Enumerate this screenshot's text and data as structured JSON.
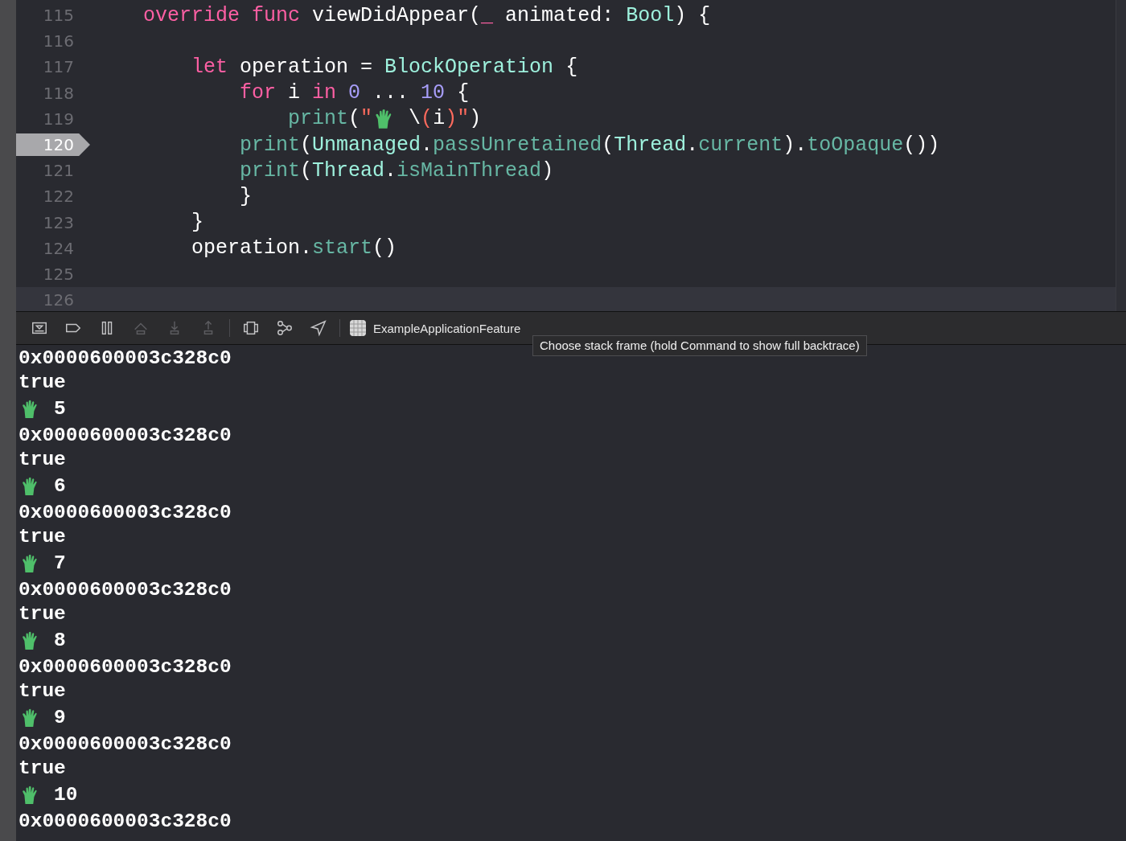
{
  "editor": {
    "lines": [
      {
        "number": "115",
        "highlighted": false,
        "pointer": false,
        "tokens": [
          {
            "kind": "kw",
            "text": "    override"
          },
          {
            "kind": "kw",
            "text": " func"
          },
          {
            "kind": "plain",
            "text": " viewDidAppear("
          },
          {
            "kind": "kw",
            "text": "_"
          },
          {
            "kind": "plain",
            "text": " animated: "
          },
          {
            "kind": "type",
            "text": "Bool"
          },
          {
            "kind": "plain",
            "text": ") {"
          }
        ]
      },
      {
        "number": "116",
        "highlighted": false,
        "pointer": false
      },
      {
        "number": "117",
        "highlighted": false,
        "pointer": false,
        "tokens": [
          {
            "kind": "kw",
            "text": "        let"
          },
          {
            "kind": "plain",
            "text": " operation = "
          },
          {
            "kind": "type",
            "text": "BlockOperation"
          },
          {
            "kind": "plain",
            "text": " {"
          }
        ]
      },
      {
        "number": "118",
        "highlighted": false,
        "pointer": false,
        "tokens": [
          {
            "kind": "kw",
            "text": "            for"
          },
          {
            "kind": "plain",
            "text": " i "
          },
          {
            "kind": "kw",
            "text": "in"
          },
          {
            "kind": "num",
            "text": " 0"
          },
          {
            "kind": "plain",
            "text": " ... "
          },
          {
            "kind": "num",
            "text": "10"
          },
          {
            "kind": "plain",
            "text": " {"
          }
        ]
      },
      {
        "number": "119",
        "highlighted": false,
        "pointer": false,
        "tokens": [
          {
            "kind": "fn",
            "text": "                print"
          },
          {
            "kind": "plain",
            "text": "("
          },
          {
            "kind": "str",
            "text": "\""
          },
          {
            "kind": "icon"
          },
          {
            "kind": "plain",
            "text": " \\"
          },
          {
            "kind": "str",
            "text": "("
          },
          {
            "kind": "plain",
            "text": "i"
          },
          {
            "kind": "str",
            "text": ")\""
          },
          {
            "kind": "plain",
            "text": ")"
          }
        ]
      },
      {
        "number": "120",
        "highlighted": false,
        "pointer": true,
        "tokens": [
          {
            "kind": "fn",
            "text": "            print"
          },
          {
            "kind": "plain",
            "text": "("
          },
          {
            "kind": "type",
            "text": "Unmanaged"
          },
          {
            "kind": "plain",
            "text": "."
          },
          {
            "kind": "fn",
            "text": "passUnretained"
          },
          {
            "kind": "plain",
            "text": "("
          },
          {
            "kind": "type",
            "text": "Thread"
          },
          {
            "kind": "plain",
            "text": "."
          },
          {
            "kind": "fn",
            "text": "current"
          },
          {
            "kind": "plain",
            "text": ")."
          },
          {
            "kind": "fn",
            "text": "toOpaque"
          },
          {
            "kind": "plain",
            "text": "())"
          }
        ]
      },
      {
        "number": "121",
        "highlighted": false,
        "pointer": false,
        "tokens": [
          {
            "kind": "fn",
            "text": "            print"
          },
          {
            "kind": "plain",
            "text": "("
          },
          {
            "kind": "type",
            "text": "Thread"
          },
          {
            "kind": "plain",
            "text": "."
          },
          {
            "kind": "fn",
            "text": "isMainThread"
          },
          {
            "kind": "plain",
            "text": ")"
          }
        ]
      },
      {
        "number": "122",
        "highlighted": false,
        "pointer": false,
        "tokens": [
          {
            "kind": "plain",
            "text": "            }"
          }
        ]
      },
      {
        "number": "123",
        "highlighted": false,
        "pointer": false,
        "tokens": [
          {
            "kind": "plain",
            "text": "        }"
          }
        ]
      },
      {
        "number": "124",
        "highlighted": false,
        "pointer": false,
        "tokens": [
          {
            "kind": "plain",
            "text": "        operation."
          },
          {
            "kind": "fn",
            "text": "start"
          },
          {
            "kind": "plain",
            "text": "()"
          }
        ]
      },
      {
        "number": "125",
        "highlighted": false,
        "pointer": false
      },
      {
        "number": "126",
        "highlighted": true,
        "pointer": false
      }
    ]
  },
  "debug_bar": {
    "buttons": [
      {
        "kind": "hide",
        "disabled": false
      },
      {
        "kind": "breakpoints",
        "disabled": false
      },
      {
        "kind": "pause",
        "disabled": false
      },
      {
        "kind": "step-over",
        "disabled": true
      },
      {
        "kind": "step-in",
        "disabled": true
      },
      {
        "kind": "step-out",
        "disabled": true
      },
      {
        "kind": "view-debugger",
        "disabled": false
      },
      {
        "kind": "memory-graph",
        "disabled": false
      },
      {
        "kind": "location",
        "disabled": false
      }
    ],
    "target": "ExampleApplicationFeature",
    "tooltip": "Choose stack frame (hold Command to show full backtrace)"
  },
  "console": {
    "lines": [
      {
        "kind": "text",
        "text": "0x0000600003c328c0"
      },
      {
        "kind": "text",
        "text": "true"
      },
      {
        "kind": "glove",
        "text": "5"
      },
      {
        "kind": "text",
        "text": "0x0000600003c328c0"
      },
      {
        "kind": "text",
        "text": "true"
      },
      {
        "kind": "glove",
        "text": "6"
      },
      {
        "kind": "text",
        "text": "0x0000600003c328c0"
      },
      {
        "kind": "text",
        "text": "true"
      },
      {
        "kind": "glove",
        "text": "7"
      },
      {
        "kind": "text",
        "text": "0x0000600003c328c0"
      },
      {
        "kind": "text",
        "text": "true"
      },
      {
        "kind": "glove",
        "text": "8"
      },
      {
        "kind": "text",
        "text": "0x0000600003c328c0"
      },
      {
        "kind": "text",
        "text": "true"
      },
      {
        "kind": "glove",
        "text": "9"
      },
      {
        "kind": "text",
        "text": "0x0000600003c328c0"
      },
      {
        "kind": "text",
        "text": "true"
      },
      {
        "kind": "glove",
        "text": "10"
      },
      {
        "kind": "text",
        "text": "0x0000600003c328c0"
      }
    ]
  }
}
